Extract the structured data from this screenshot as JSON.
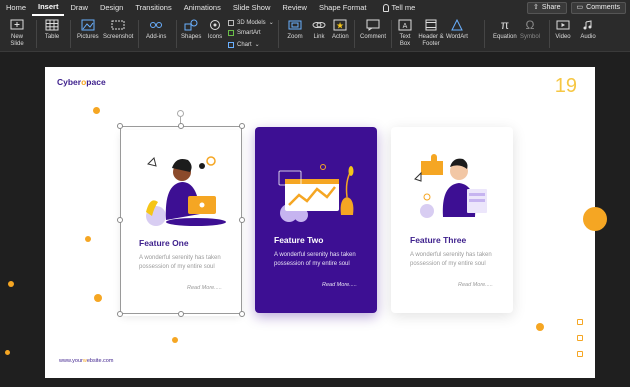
{
  "tabs": [
    "Home",
    "Insert",
    "Draw",
    "Design",
    "Transitions",
    "Animations",
    "Slide Show",
    "Review",
    "Shape Format"
  ],
  "active_tab": "Insert",
  "tell_me": "Tell me",
  "share": "Share",
  "comments": "Comments",
  "ribbon": {
    "new_slide": "New Slide",
    "table": "Table",
    "pictures": "Pictures",
    "screenshot": "Screenshot",
    "addins": "Add-ins",
    "shapes": "Shapes",
    "icons": "Icons",
    "models3d": "3D Models",
    "smartart": "SmartArt",
    "chart": "Chart",
    "zoom": "Zoom",
    "link": "Link",
    "action": "Action",
    "comment": "Comment",
    "textbox": "Text Box",
    "header_footer": "Header & Footer",
    "wordart": "WordArt",
    "equation": "Equation",
    "symbol": "Symbol",
    "video": "Video",
    "audio": "Audio"
  },
  "slide": {
    "logo_pre": "Cyber",
    "logo_o": "o",
    "logo_post": "pace",
    "page_number": "19",
    "website_pre": "www.your",
    "website_o": "w",
    "website_post": "ebsite.com",
    "cards": [
      {
        "title": "Feature One",
        "desc": "A wonderful serenity has taken possession of my entire soul",
        "more": "Read More....."
      },
      {
        "title": "Feature Two",
        "desc": "A wonderful serenity has taken possession of my entire soul",
        "more": "Read More....."
      },
      {
        "title": "Feature Three",
        "desc": "A wonderful serenity has taken possession of my entire soul",
        "more": "Read More....."
      }
    ]
  },
  "colors": {
    "accent_purple": "#3d0f93",
    "accent_yellow": "#f5a623"
  }
}
